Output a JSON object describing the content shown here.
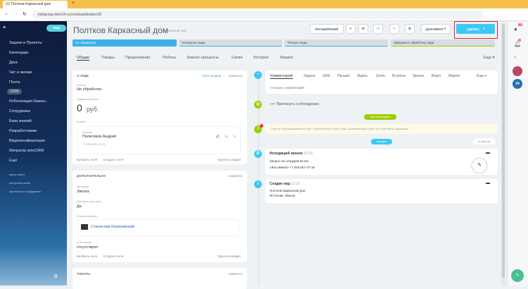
{
  "browser": {
    "tab_title": "(1) Полтков Каркасный дом",
    "url": "intelgroup.bitrix24.ru/crm/lead/details/18/"
  },
  "sidebar": {
    "add_label": "ЛИД",
    "items": [
      "Задачи и Проекты",
      "Календарь",
      "Диск",
      "Чат и звонки",
      "Почта",
      "CRM",
      "Роботизация бизнес...",
      "Сотрудники",
      "База знаний",
      "Разработчикам",
      "Видеоконференции",
      "Мигратор amoCRM",
      "Ещё"
    ],
    "links": [
      "карта сайта",
      "настроить меню",
      "пригласить сотрудников"
    ]
  },
  "header": {
    "title": "Полтков Каркасный дом",
    "subtitle": "Повторный лид",
    "buttons": {
      "extensions": "РАСШИРЕНИЯ",
      "document": "ДОКУМЕНТ",
      "deal": "СДЕЛКА"
    }
  },
  "stages": [
    "Не обработан",
    "Холодные лиды",
    "Теплые лиды",
    "Завершить обработку лида"
  ],
  "tabs": [
    "Общие",
    "Товары",
    "Предложения",
    "Роботы",
    "Бизнес-процессы",
    "Связи",
    "История",
    "Маркет",
    "Еще"
  ],
  "about": {
    "title": "О ЛИДЕ",
    "acia": "ACIA-скоринг",
    "edit": "изменить",
    "status_label": "Статус",
    "status": "Не обработан",
    "sum_label": "Сумма и валюта",
    "sum": "0",
    "currency": "руб.",
    "client_label": "Клиент",
    "contact_label": "Контакт",
    "contact": "Политиков Андрей",
    "phone": "+7 929 657-27-19",
    "select_field": "Выбрать поле",
    "create_field": "Создать поле",
    "delete_section": "Удалить раздел"
  },
  "extra": {
    "title": "ДОПОЛНИТЕЛЬНО",
    "edit": "изменить",
    "source_label": "Источник",
    "source": "Звонок",
    "access_label": "Доступен для всех",
    "access": "Да",
    "resp_label": "Ответственный",
    "resp": "Станислав Кориневский",
    "utm_label": "UTM-метки",
    "utm": "отсутствуют",
    "select_field": "Выбрать поле",
    "create_field": "Создать поле",
    "delete_section": "Удалить раздел"
  },
  "goods": {
    "title": "ТОВАРЫ",
    "edit": "изменить"
  },
  "timeline": {
    "tabs": [
      "Комментарий",
      "Задача",
      "SMS",
      "Письмо",
      "Ждать",
      "Zoom",
      "Встреча",
      "Звонок",
      "Визит",
      "Маркет",
      "Еще"
    ],
    "comment_placeholder": "Оставить комментарий",
    "invite": "Пригласить к обсуждению",
    "planned": "Запланировано",
    "warning": "У вас нет запланированных дел. Переместить статус лида, запланировать дело или поставить ожидание.",
    "today": "сегодня",
    "filter": "Фильтр",
    "events": [
      {
        "title": "Исходящий звонок",
        "time": "13:18",
        "line1": "Запрос на сотрудничество",
        "line2": "<Без имени> +7 929 657-27-19"
      },
      {
        "title": "Создан лид",
        "time": "13:16",
        "line1": "Полтков Каркасный дом",
        "line2": "Источник: Звонок"
      }
    ]
  },
  "right": {
    "badge1": "16",
    "badge2": "1",
    "b24": "24"
  }
}
